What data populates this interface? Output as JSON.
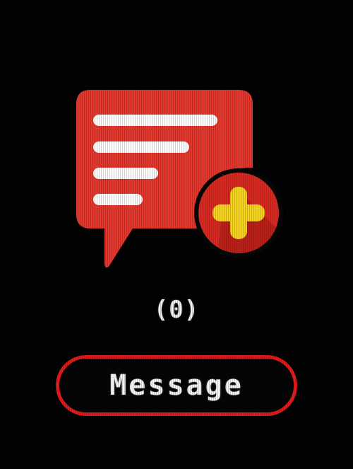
{
  "app": {
    "icon": "message-add-icon",
    "count_text": "(0)",
    "button_label": "Message"
  },
  "colors": {
    "background": "#020202",
    "bubble_red": "#e4382e",
    "badge_red": "#d92a22",
    "plus_yellow": "#f5d31f",
    "line_white": "#ffffff",
    "button_border": "#e11b1b",
    "text": "#f2f2f2"
  }
}
